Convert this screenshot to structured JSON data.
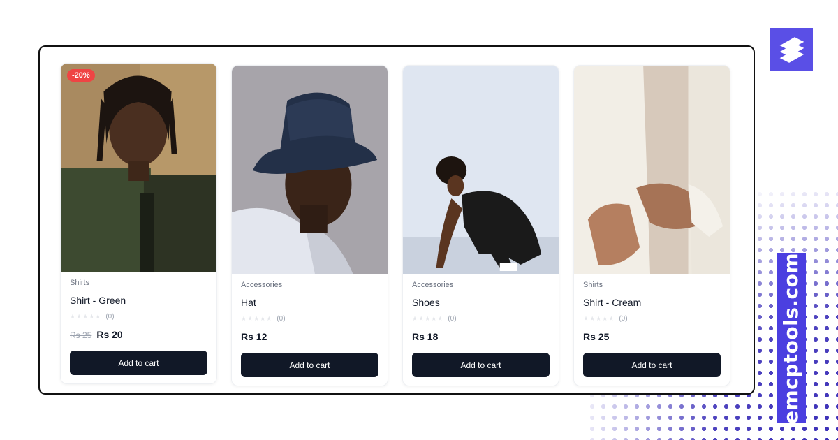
{
  "brand": {
    "domain": "emcptools.com",
    "logo_icon": "stacked-layers-icon",
    "accent": "#4b3fe0"
  },
  "colors": {
    "button_bg": "#111827",
    "discount_badge": "#ef4444"
  },
  "products": [
    {
      "category": "Shirts",
      "name": "Shirt - Green",
      "badge": "-20%",
      "star_icon": "star-icon",
      "rating_count": "(0)",
      "old_price": "Rs 25",
      "price": "Rs 20",
      "cta": "Add to cart"
    },
    {
      "category": "Accessories",
      "name": "Hat",
      "badge": "",
      "star_icon": "star-icon",
      "rating_count": "(0)",
      "old_price": "",
      "price": "Rs 12",
      "cta": "Add to cart"
    },
    {
      "category": "Accessories",
      "name": "Shoes",
      "badge": "",
      "star_icon": "star-icon",
      "rating_count": "(0)",
      "old_price": "",
      "price": "Rs 18",
      "cta": "Add to cart"
    },
    {
      "category": "Shirts",
      "name": "Shirt - Cream",
      "badge": "",
      "star_icon": "star-icon",
      "rating_count": "(0)",
      "old_price": "",
      "price": "Rs 25",
      "cta": "Add to cart"
    }
  ]
}
